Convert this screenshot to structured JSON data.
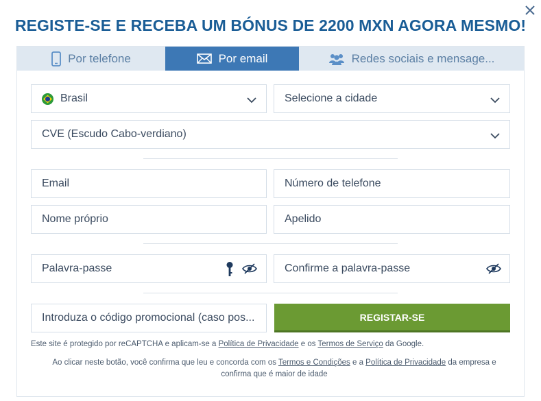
{
  "title": "REGISTE-SE E RECEBA UM BÓNUS DE 2200 MXN AGORA MESMO!",
  "tabs": [
    {
      "label": "Por telefone",
      "icon": "phone-icon",
      "active": false
    },
    {
      "label": "Por email",
      "icon": "envelope-icon",
      "active": true
    },
    {
      "label": "Redes sociais e mensage...",
      "icon": "users-icon",
      "active": false
    }
  ],
  "form": {
    "country": "Brasil",
    "city_placeholder": "Selecione a cidade",
    "currency": "CVE (Escudo Cabo-verdiano)",
    "email_placeholder": "Email",
    "phone_placeholder": "Número de telefone",
    "first_name_placeholder": "Nome próprio",
    "last_name_placeholder": "Apelido",
    "password_placeholder": "Palavra-passe",
    "confirm_password_placeholder": "Confirme a palavra-passe",
    "promo_placeholder": "Introduza o código promocional (caso pos...",
    "register_label": "REGISTAR-SE"
  },
  "notes": {
    "recaptcha_prefix": "Este site é protegido por reCAPTCHA e aplicam-se a ",
    "privacy_link": "Política de Privacidade",
    "recaptcha_mid": " e os ",
    "terms_link": "Termos de Serviço",
    "recaptcha_suffix": " da Google.",
    "consent_prefix": "Ao clicar neste botão, você confirma que leu e concorda com os ",
    "conditions_link": "Termos e Condições",
    "consent_mid": " e a ",
    "privacy_link2": "Política de Privacidade",
    "consent_suffix": " da empresa e confirma que é maior de idade"
  },
  "colors": {
    "title": "#1a5d96",
    "tab_active": "#3d78b5",
    "tab_bar": "#dfe8f1",
    "register_button": "#6b9a33"
  }
}
